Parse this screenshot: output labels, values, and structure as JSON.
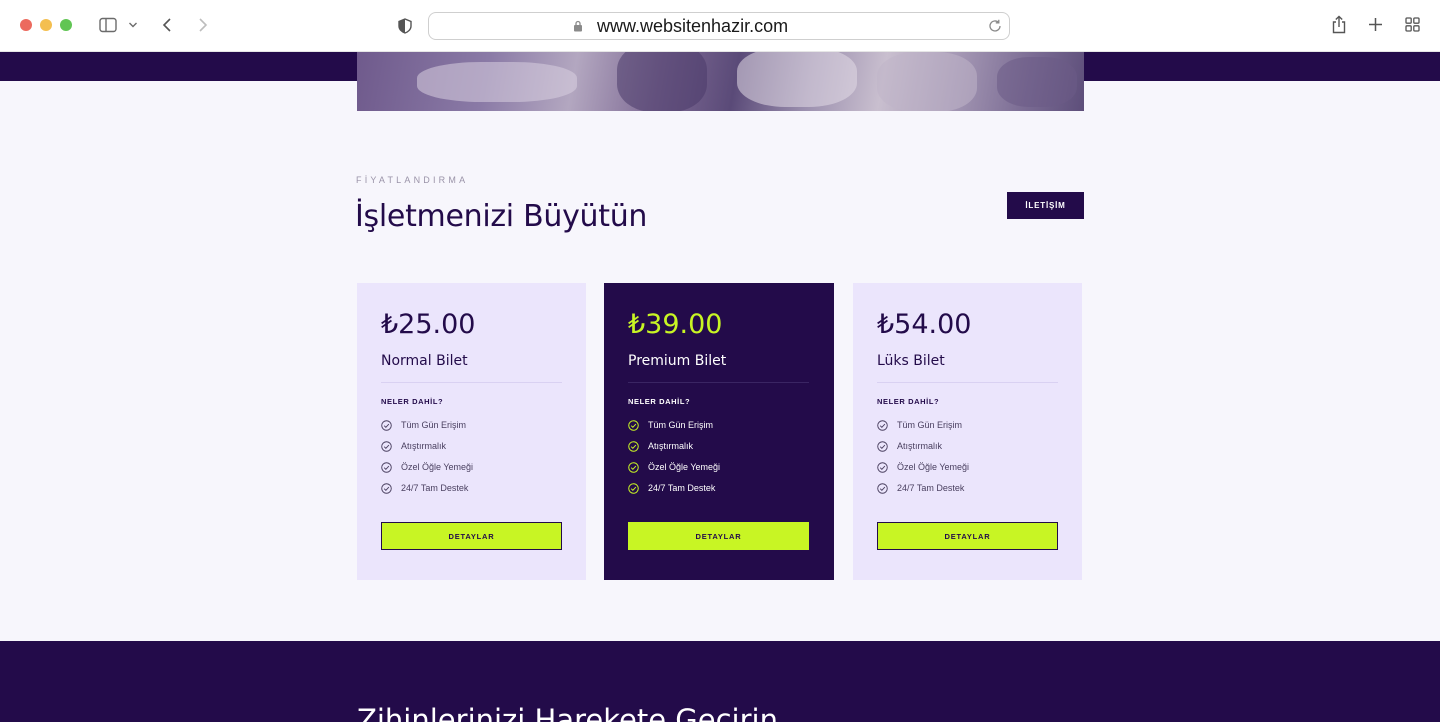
{
  "browser": {
    "url": "www.websitenhazir.com"
  },
  "section": {
    "eyebrow": "FİYATLANDIRMA",
    "title": "İşletmenizi Büyütün",
    "contact_label": "İLETİŞİM"
  },
  "plans": [
    {
      "price": "₺25.00",
      "name": "Normal Bilet",
      "includes_label": "NELER DAHİL?",
      "features": [
        "Tüm Gün Erişim",
        "Atıştırmalık",
        "Özel Öğle Yemeği",
        "24/7 Tam Destek"
      ],
      "button_label": "DETAYLAR"
    },
    {
      "price": "₺39.00",
      "name": "Premium Bilet",
      "includes_label": "NELER DAHİL?",
      "features": [
        "Tüm Gün Erişim",
        "Atıştırmalık",
        "Özel Öğle Yemeği",
        "24/7 Tam Destek"
      ],
      "button_label": "DETAYLAR"
    },
    {
      "price": "₺54.00",
      "name": "Lüks Bilet",
      "includes_label": "NELER DAHİL?",
      "features": [
        "Tüm Gün Erişim",
        "Atıştırmalık",
        "Özel Öğle Yemeği",
        "24/7 Tam Destek"
      ],
      "button_label": "DETAYLAR"
    }
  ],
  "next_section": {
    "title": "Zihinlerinizi Harekete Geçirin"
  },
  "colors": {
    "brand_dark": "#230b4a",
    "accent_lime": "#c8f524",
    "card_light": "#ebe5fc",
    "page_bg": "#f7f6fc"
  },
  "icons": {
    "feature": "check-circle-icon"
  }
}
